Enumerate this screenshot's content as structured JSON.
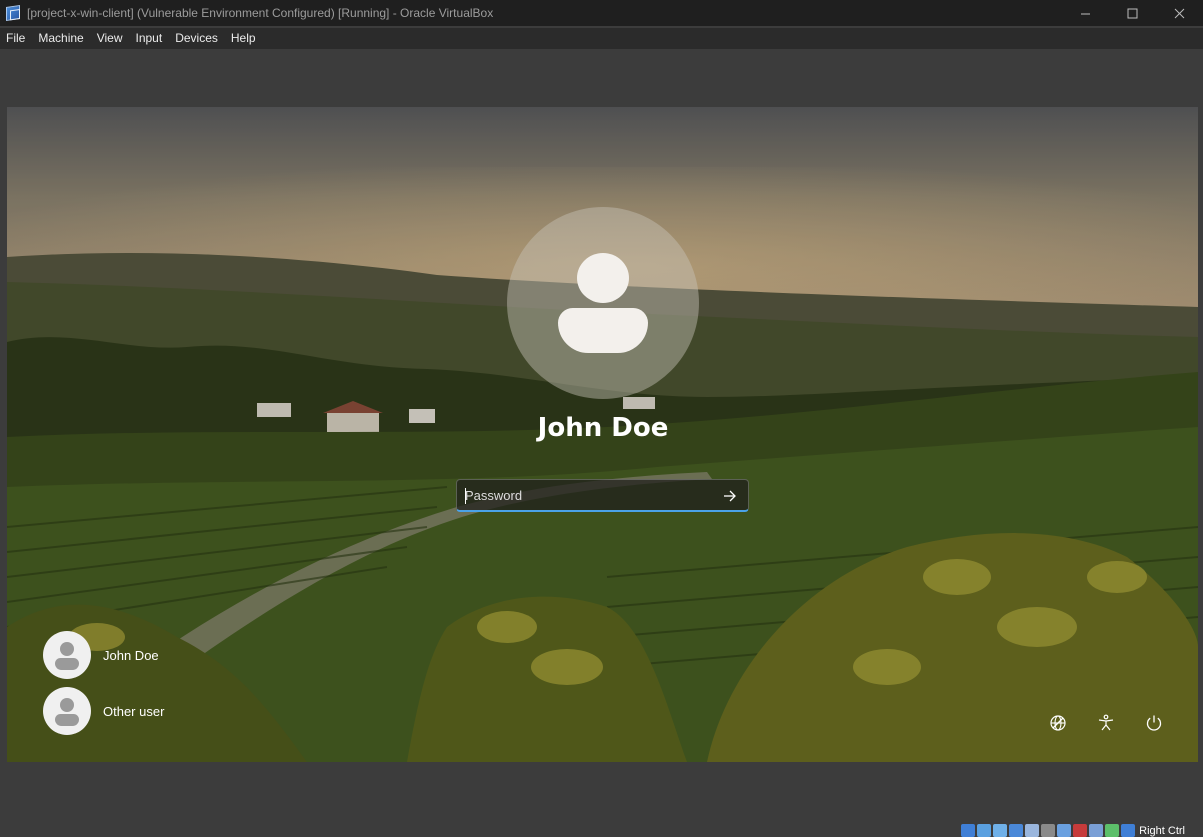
{
  "window": {
    "title": "[project-x-win-client] (Vulnerable Environment Configured) [Running] - Oracle VirtualBox"
  },
  "menu": {
    "items": [
      "File",
      "Machine",
      "View",
      "Input",
      "Devices",
      "Help"
    ]
  },
  "login": {
    "user_name": "John Doe",
    "password_placeholder": "Password",
    "users": [
      {
        "label": "John Doe"
      },
      {
        "label": "Other user"
      }
    ]
  },
  "statusbar": {
    "host_key": "Right Ctrl",
    "tray_icons": [
      "hard-disk-icon",
      "optical-drive-icon",
      "audio-icon",
      "network-icon",
      "usb-icon",
      "shared-folders-icon",
      "display-icon",
      "video-capture-icon",
      "virtualization-icon",
      "guest-additions-icon",
      "keyboard-capture-icon"
    ],
    "tray_colors": [
      "#3f7fd6",
      "#5aa0e0",
      "#6fb0e8",
      "#4a88d8",
      "#9ab6dd",
      "#8a8a8a",
      "#6aa0e0",
      "#c63b3b",
      "#7a9fd6",
      "#5cbf6a",
      "#3f7fd6"
    ]
  }
}
